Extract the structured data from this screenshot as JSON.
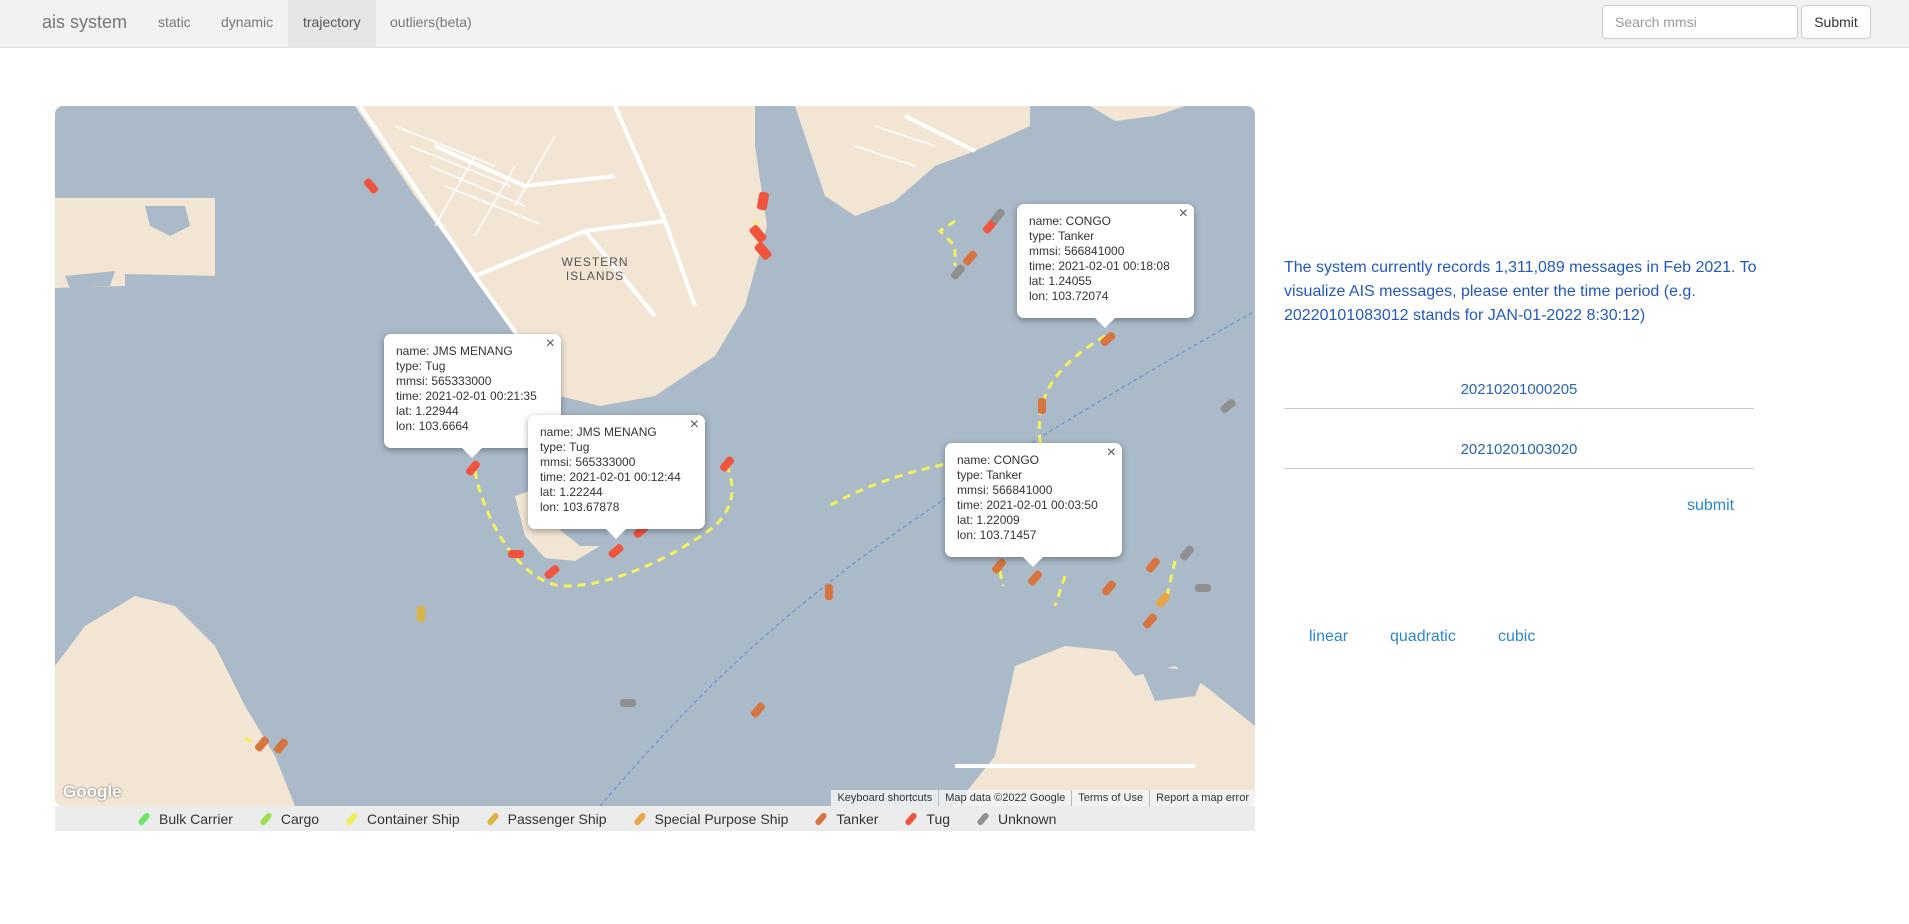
{
  "nav": {
    "brand": "ais system",
    "links": [
      "static",
      "dynamic",
      "trajectory",
      "outliers(beta)"
    ],
    "active": "trajectory",
    "search_placeholder": "Search mmsi",
    "search_button": "Submit"
  },
  "map": {
    "area_label_line1": "WESTERN",
    "area_label_line2": "ISLANDS",
    "google_logo": "Google",
    "attribution": [
      "Keyboard shortcuts",
      "Map data ©2022 Google",
      "Terms of Use",
      "Report a map error"
    ],
    "colors": {
      "water": "#aabac8",
      "land": "#f2e5d3",
      "road": "#ffffff",
      "trajectory": "#f4f15a"
    },
    "popups": [
      {
        "name": "name: JMS MENANG",
        "type": "type: Tug",
        "mmsi": "mmsi: 565333000",
        "time": "time: 2021-02-01 00:21:35",
        "lat": "lat: 1.22944",
        "lon": "lon: 103.6664"
      },
      {
        "name": "name: JMS MENANG",
        "type": "type: Tug",
        "mmsi": "mmsi: 565333000",
        "time": "time: 2021-02-01 00:12:44",
        "lat": "lat: 1.22244",
        "lon": "lon: 103.67878"
      },
      {
        "name": "name: CONGO",
        "type": "type: Tanker",
        "mmsi": "mmsi: 566841000",
        "time": "time: 2021-02-01 00:18:08",
        "lat": "lat: 1.24055",
        "lon": "lon: 103.72074"
      },
      {
        "name": "name: CONGO",
        "type": "type: Tanker",
        "mmsi": "mmsi: 566841000",
        "time": "time: 2021-02-01 00:03:50",
        "lat": "lat: 1.22009",
        "lon": "lon: 103.71457"
      }
    ]
  },
  "legend": [
    {
      "label": "Bulk Carrier",
      "color": "#6fe66a"
    },
    {
      "label": "Cargo",
      "color": "#9be04a"
    },
    {
      "label": "Container Ship",
      "color": "#f2ee57"
    },
    {
      "label": "Passenger Ship",
      "color": "#d9b445"
    },
    {
      "label": "Special Purpose Ship",
      "color": "#eaa645"
    },
    {
      "label": "Tanker",
      "color": "#d8743e"
    },
    {
      "label": "Tug",
      "color": "#f0543e"
    },
    {
      "label": "Unknown",
      "color": "#909090"
    }
  ],
  "panel": {
    "description": "The system currently records 1,311,089 messages in Feb 2021. To visualize AIS messages, please enter the time period (e.g. 20220101083012 stands for JAN-01-2022 8:30:12)",
    "start_time": "20210201000205",
    "end_time": "20210201003020",
    "submit": "submit",
    "interpolation": [
      "linear",
      "quadratic",
      "cubic"
    ]
  }
}
